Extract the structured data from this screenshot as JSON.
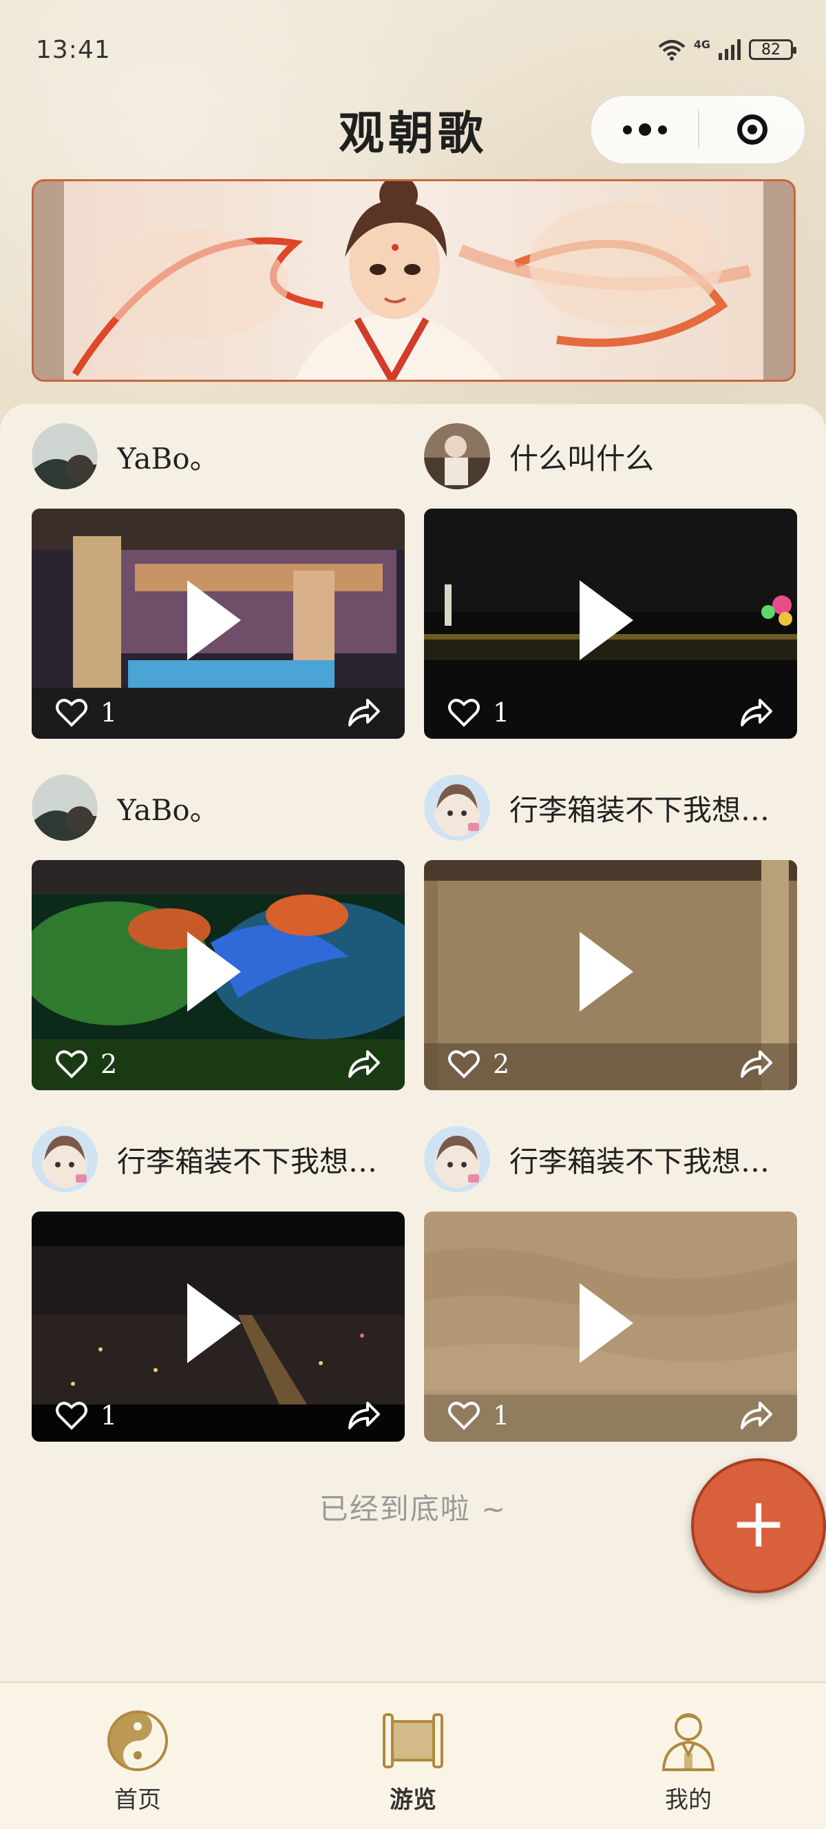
{
  "status_bar": {
    "time": "13:41",
    "network": "4G",
    "battery": "82"
  },
  "header": {
    "title": "观朝歌"
  },
  "banner": {
    "slide_count": 1,
    "active_slide": 1
  },
  "feed": {
    "posts": [
      {
        "author": "YaBo。",
        "likes": "1"
      },
      {
        "author": "什么叫什么",
        "likes": "1"
      },
      {
        "author": "YaBo。",
        "likes": "2"
      },
      {
        "author": "行李箱装不下我想…",
        "likes": "2"
      },
      {
        "author": "行李箱装不下我想…",
        "likes": "1"
      },
      {
        "author": "行李箱装不下我想…",
        "likes": "1"
      }
    ],
    "end_text": "已经到底啦 ~"
  },
  "fab": {
    "label": "+"
  },
  "tabbar": {
    "tabs": [
      {
        "label": "首页",
        "icon": "taiji-icon"
      },
      {
        "label": "游览",
        "icon": "scroll-icon",
        "active": true
      },
      {
        "label": "我的",
        "icon": "person-icon"
      }
    ]
  },
  "colors": {
    "accent": "#d8603a",
    "background": "#f6f0e4",
    "icon_gold": "#b08a3c"
  }
}
